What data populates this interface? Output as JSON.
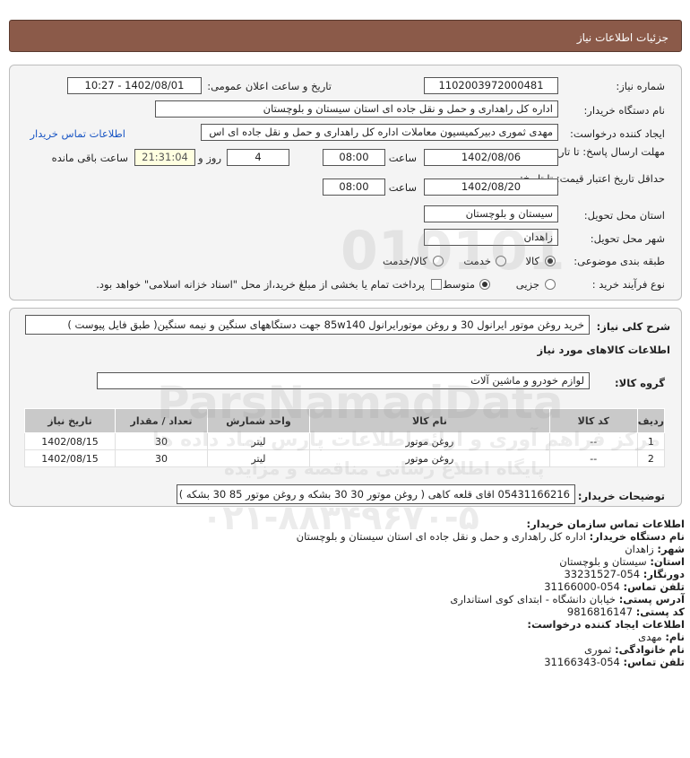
{
  "header": {
    "title": "جزئیات اطلاعات نیاز"
  },
  "form": {
    "need_number_label": "شماره نیاز:",
    "need_number": "1102003972000481",
    "announce_label": "تاریخ و ساعت اعلان عمومی:",
    "announce_value": "1402/08/01 - 10:27",
    "buyer_label": "نام دستگاه خریدار:",
    "buyer_value": "اداره کل راهداری و حمل و نقل جاده ای استان سیستان و بلوچستان",
    "creator_label": "ایجاد کننده درخواست:",
    "creator_value": "مهدی ثموری دبیرکمیسیون معاملات اداره کل راهداری و حمل و نقل جاده ای اس",
    "contact_link": "اطلاعات تماس خریدار",
    "deadline_label": "مهلت ارسال پاسخ: تا تاریخ:",
    "deadline_date": "1402/08/06",
    "time_label": "ساعت",
    "deadline_time": "08:00",
    "days_value": "4",
    "days_label": "روز و",
    "remaining_time": "21:31:04",
    "remaining_label": "ساعت باقی مانده",
    "validity_label": "حداقل تاریخ اعتبار قیمت: تا تاریخ:",
    "validity_date": "1402/08/20",
    "validity_time": "08:00",
    "province_label": "استان محل تحویل:",
    "province_value": "سیستان و بلوچستان",
    "city_label": "شهر محل تحویل:",
    "city_value": "زاهدان",
    "category_label": "طبقه بندی موضوعی:",
    "cat_goods": "کالا",
    "cat_service": "خدمت",
    "cat_both": "کالا/خدمت",
    "process_label": "نوع فرآیند خرید :",
    "proc_partial": "جزیی",
    "proc_medium": "متوسط",
    "payment_note": "پرداخت تمام یا بخشی از مبلغ خرید،از محل \"اسناد خزانه اسلامی\" خواهد بود."
  },
  "summary": {
    "label": "شرح کلی نیاز:",
    "value": "خرید روغن موتور ایرانول 30 و روغن موتورایرانول 85w140 جهت دستگاههای سنگین و نیمه سنگین( طبق فایل پیوست )",
    "goods_info_title": "اطلاعات کالاهای مورد نیاز",
    "group_label": "گروه کالا:",
    "group_value": "لوازم خودرو و ماشین آلات"
  },
  "table": {
    "headers": [
      "ردیف",
      "کد کالا",
      "نام کالا",
      "واحد شمارش",
      "تعداد / مقدار",
      "تاریخ نیاز"
    ],
    "rows": [
      [
        "1",
        "--",
        "روغن موتور",
        "لیتر",
        "30",
        "1402/08/15"
      ],
      [
        "2",
        "--",
        "روغن موتور",
        "لیتر",
        "30",
        "1402/08/15"
      ]
    ]
  },
  "buyer_notes": {
    "label": "توضیحات خریدار:",
    "value": "05431166216 اقای قلعه کاهی ( روغن موتور 30 30 بشکه و روغن موتور 85 30 بشکه )"
  },
  "contact": {
    "org_title": "اطلاعات تماس سازمان خریدار:",
    "buyer_name_label": "نام دستگاه خریدار:",
    "buyer_name": "اداره کل راهداری و حمل و نقل جاده ای استان سیستان و بلوچستان",
    "city_label": "شهر:",
    "city": "زاهدان",
    "province_label": "استان:",
    "province": "سیستان و بلوچستان",
    "fax_label": "دورنگار:",
    "fax": "054-33231527",
    "phone_label": "تلفن تماس:",
    "phone": "054-31166000",
    "address_label": "آدرس پستی:",
    "address": "خیابان دانشگاه - ابتدای کوی استانداری",
    "postal_label": "کد پستی:",
    "postal": "9816816147",
    "creator_title": "اطلاعات ایجاد کننده درخواست:",
    "name_label": "نام:",
    "name": "مهدی",
    "family_label": "نام خانوادگی:",
    "family": "ثموری",
    "creator_phone_label": "تلفن تماس:",
    "creator_phone": "054-31166343"
  },
  "watermark": {
    "digits": "010101",
    "brand": "ParsNamadData",
    "persian": "مرکز فراهم آوری و ارائه اطلاعات پارس نماد داده ها",
    "sub": "پایگاه اطلاع رسانی مناقصه و مزایده",
    "phone": "۰۲۱-۸۸۳۴۹۶۷۰-۵"
  }
}
